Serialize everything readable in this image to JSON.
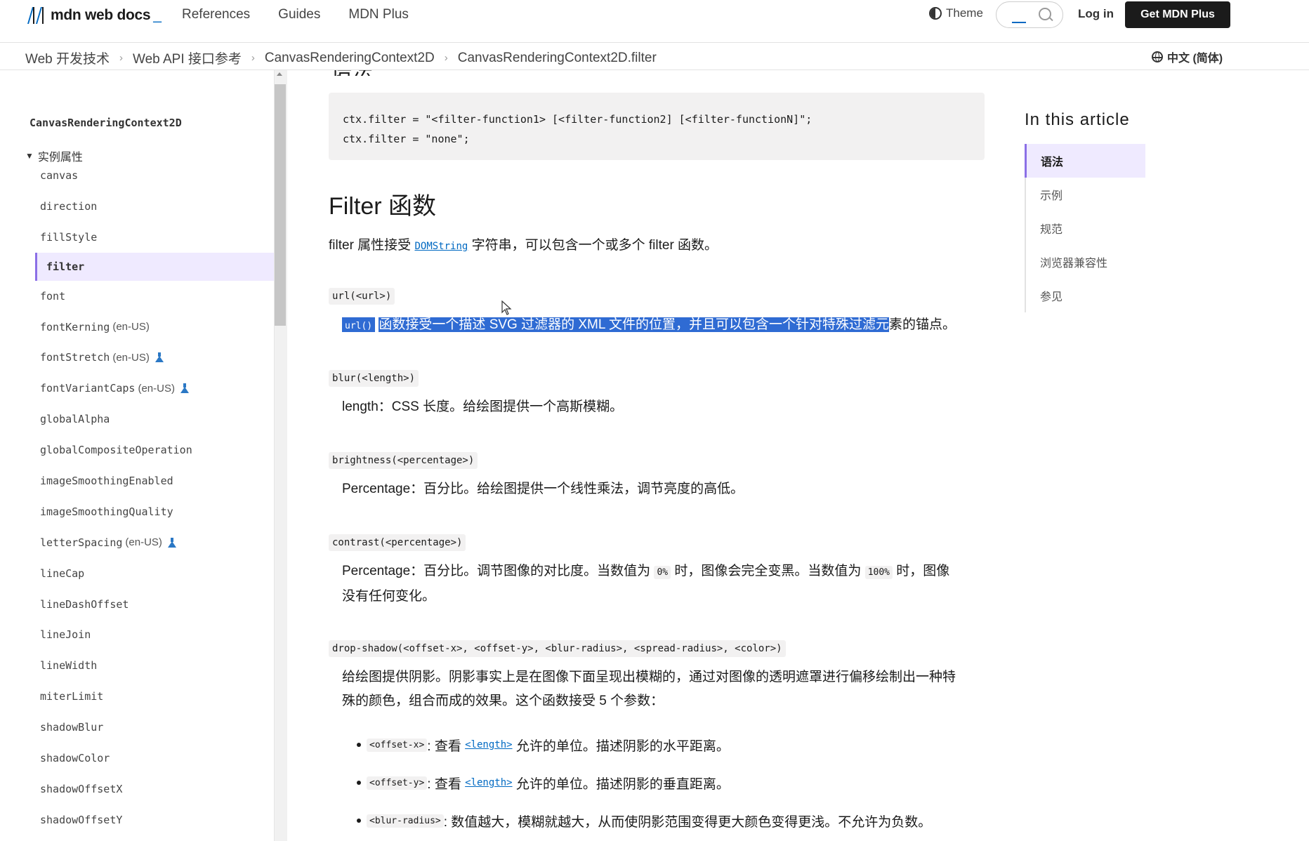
{
  "header": {
    "logo_text": "mdn web docs",
    "logo_underscore": "_",
    "nav": [
      "References",
      "Guides",
      "MDN Plus"
    ],
    "theme_label": "Theme",
    "login_label": "Log in",
    "cta_label": "Get MDN Plus"
  },
  "breadcrumb": [
    "Web 开发技术",
    "Web API 接口参考",
    "CanvasRenderingContext2D",
    "CanvasRenderingContext2D.filter"
  ],
  "language": "中文 (简体)",
  "sidebar": {
    "title": "CanvasRenderingContext2D",
    "group_label": "实例属性",
    "items": [
      {
        "label": "canvas",
        "locale": "",
        "experimental": false,
        "active": false
      },
      {
        "label": "direction",
        "locale": "",
        "experimental": false,
        "active": false
      },
      {
        "label": "fillStyle",
        "locale": "",
        "experimental": false,
        "active": false
      },
      {
        "label": "filter",
        "locale": "",
        "experimental": false,
        "active": true
      },
      {
        "label": "font",
        "locale": "",
        "experimental": false,
        "active": false
      },
      {
        "label": "fontKerning",
        "locale": "(en-US)",
        "experimental": false,
        "active": false
      },
      {
        "label": "fontStretch",
        "locale": "(en-US)",
        "experimental": true,
        "active": false
      },
      {
        "label": "fontVariantCaps",
        "locale": "(en-US)",
        "experimental": true,
        "active": false
      },
      {
        "label": "globalAlpha",
        "locale": "",
        "experimental": false,
        "active": false
      },
      {
        "label": "globalCompositeOperation",
        "locale": "",
        "experimental": false,
        "active": false
      },
      {
        "label": "imageSmoothingEnabled",
        "locale": "",
        "experimental": false,
        "active": false
      },
      {
        "label": "imageSmoothingQuality",
        "locale": "",
        "experimental": false,
        "active": false
      },
      {
        "label": "letterSpacing",
        "locale": "(en-US)",
        "experimental": true,
        "active": false
      },
      {
        "label": "lineCap",
        "locale": "",
        "experimental": false,
        "active": false
      },
      {
        "label": "lineDashOffset",
        "locale": "",
        "experimental": false,
        "active": false
      },
      {
        "label": "lineJoin",
        "locale": "",
        "experimental": false,
        "active": false
      },
      {
        "label": "lineWidth",
        "locale": "",
        "experimental": false,
        "active": false
      },
      {
        "label": "miterLimit",
        "locale": "",
        "experimental": false,
        "active": false
      },
      {
        "label": "shadowBlur",
        "locale": "",
        "experimental": false,
        "active": false
      },
      {
        "label": "shadowColor",
        "locale": "",
        "experimental": false,
        "active": false
      },
      {
        "label": "shadowOffsetX",
        "locale": "",
        "experimental": false,
        "active": false
      },
      {
        "label": "shadowOffsetY",
        "locale": "",
        "experimental": false,
        "active": false
      }
    ]
  },
  "main": {
    "clipped_heading": "语法",
    "code_lines": [
      "ctx.filter = \"<filter-function1> [<filter-function2] [<filter-functionN]\";",
      "ctx.filter = \"none\";"
    ],
    "section_heading": "Filter 函数",
    "intro_before": "filter 属性接受",
    "intro_link": "DOMString",
    "intro_after": "字符串，可以包含一个或多个 filter 函数。",
    "url_term": "url(<url>)",
    "url_desc_chip": "url()",
    "url_desc_selected": "函数接受一个描述 SVG 过滤器的 XML 文件的位置，并且可以包含一个针对特殊过滤元",
    "url_desc_rest": "素的锚点。",
    "blur_term": "blur(<length>)",
    "blur_desc": "length：CSS 长度。给绘图提供一个高斯模糊。",
    "brightness_term": "brightness(<percentage>)",
    "brightness_desc": "Percentage：百分比。给绘图提供一个线性乘法，调节亮度的高低。",
    "contrast_term": "contrast(<percentage>)",
    "contrast_desc_1": "Percentage：百分比。调节图像的对比度。当数值为",
    "contrast_chip_1": "0%",
    "contrast_desc_2": "时，图像会完全变黑。当数值为",
    "contrast_chip_2": "100%",
    "contrast_desc_3": "时，图像",
    "contrast_desc_4": "没有任何变化。",
    "dropshadow_term": "drop-shadow(<offset-x>, <offset-y>, <blur-radius>, <spread-radius>, <color>)",
    "dropshadow_desc_1": "给绘图提供阴影。阴影事实上是在图像下面呈现出模糊的，通过对图像的透明遮罩进行偏移绘制出一种特",
    "dropshadow_desc_2": "殊的颜色，组合而成的效果。这个函数接受 5 个参数：",
    "bullets": [
      {
        "chip": "<offset-x>",
        "pre": ": 查看",
        "link": "<length>",
        "post": "允许的单位。描述阴影的水平距离。"
      },
      {
        "chip": "<offset-y>",
        "pre": ": 查看",
        "link": "<length>",
        "post": "允许的单位。描述阴影的垂直距离。"
      },
      {
        "chip": "<blur-radius>",
        "pre": ": 数值越大，模糊就越大，从而使阴影范围变得更大颜色变得更浅。不允许为负数。",
        "link": "",
        "post": ""
      }
    ]
  },
  "toc": {
    "title": "In this article",
    "items": [
      "语法",
      "示例",
      "规范",
      "浏览器兼容性",
      "参见"
    ],
    "active_index": 0
  },
  "colors": {
    "accent_purple": "#8b6fe6",
    "active_bg": "#efeaff",
    "link_blue": "#0069c2",
    "selection": "#2f6bd3"
  }
}
